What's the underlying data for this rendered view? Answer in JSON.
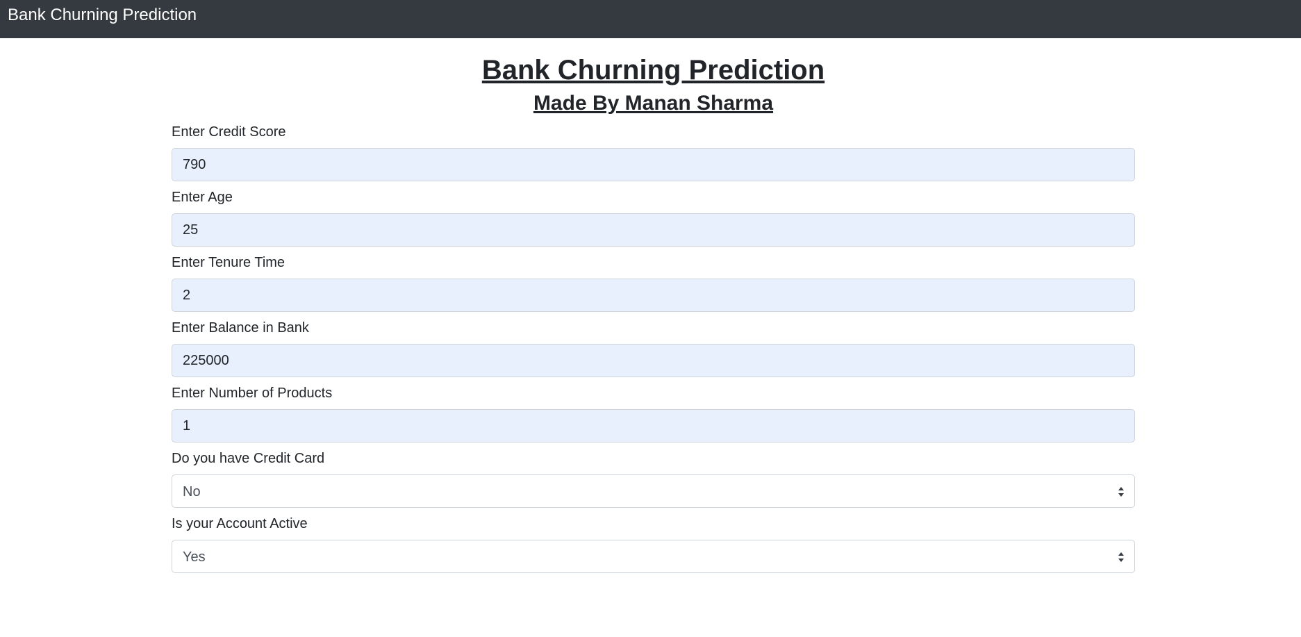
{
  "navbar": {
    "brand": "Bank Churning Prediction"
  },
  "header": {
    "title": "Bank Churning Prediction",
    "subtitle": "Made By Manan Sharma"
  },
  "form": {
    "credit_score": {
      "label": "Enter Credit Score",
      "value": "790"
    },
    "age": {
      "label": "Enter Age",
      "value": "25"
    },
    "tenure": {
      "label": "Enter Tenure Time",
      "value": "2"
    },
    "balance": {
      "label": "Enter Balance in Bank",
      "value": "225000"
    },
    "products": {
      "label": "Enter Number of Products",
      "value": "1"
    },
    "credit_card": {
      "label": "Do you have Credit Card",
      "selected": "No"
    },
    "active": {
      "label": "Is your Account Active",
      "selected": "Yes"
    }
  },
  "icons": {
    "select_arrow": "select-arrows-icon"
  },
  "colors": {
    "navbar_bg": "#343a40",
    "autofill_bg": "#e8f0fe",
    "border": "#ced4da"
  }
}
